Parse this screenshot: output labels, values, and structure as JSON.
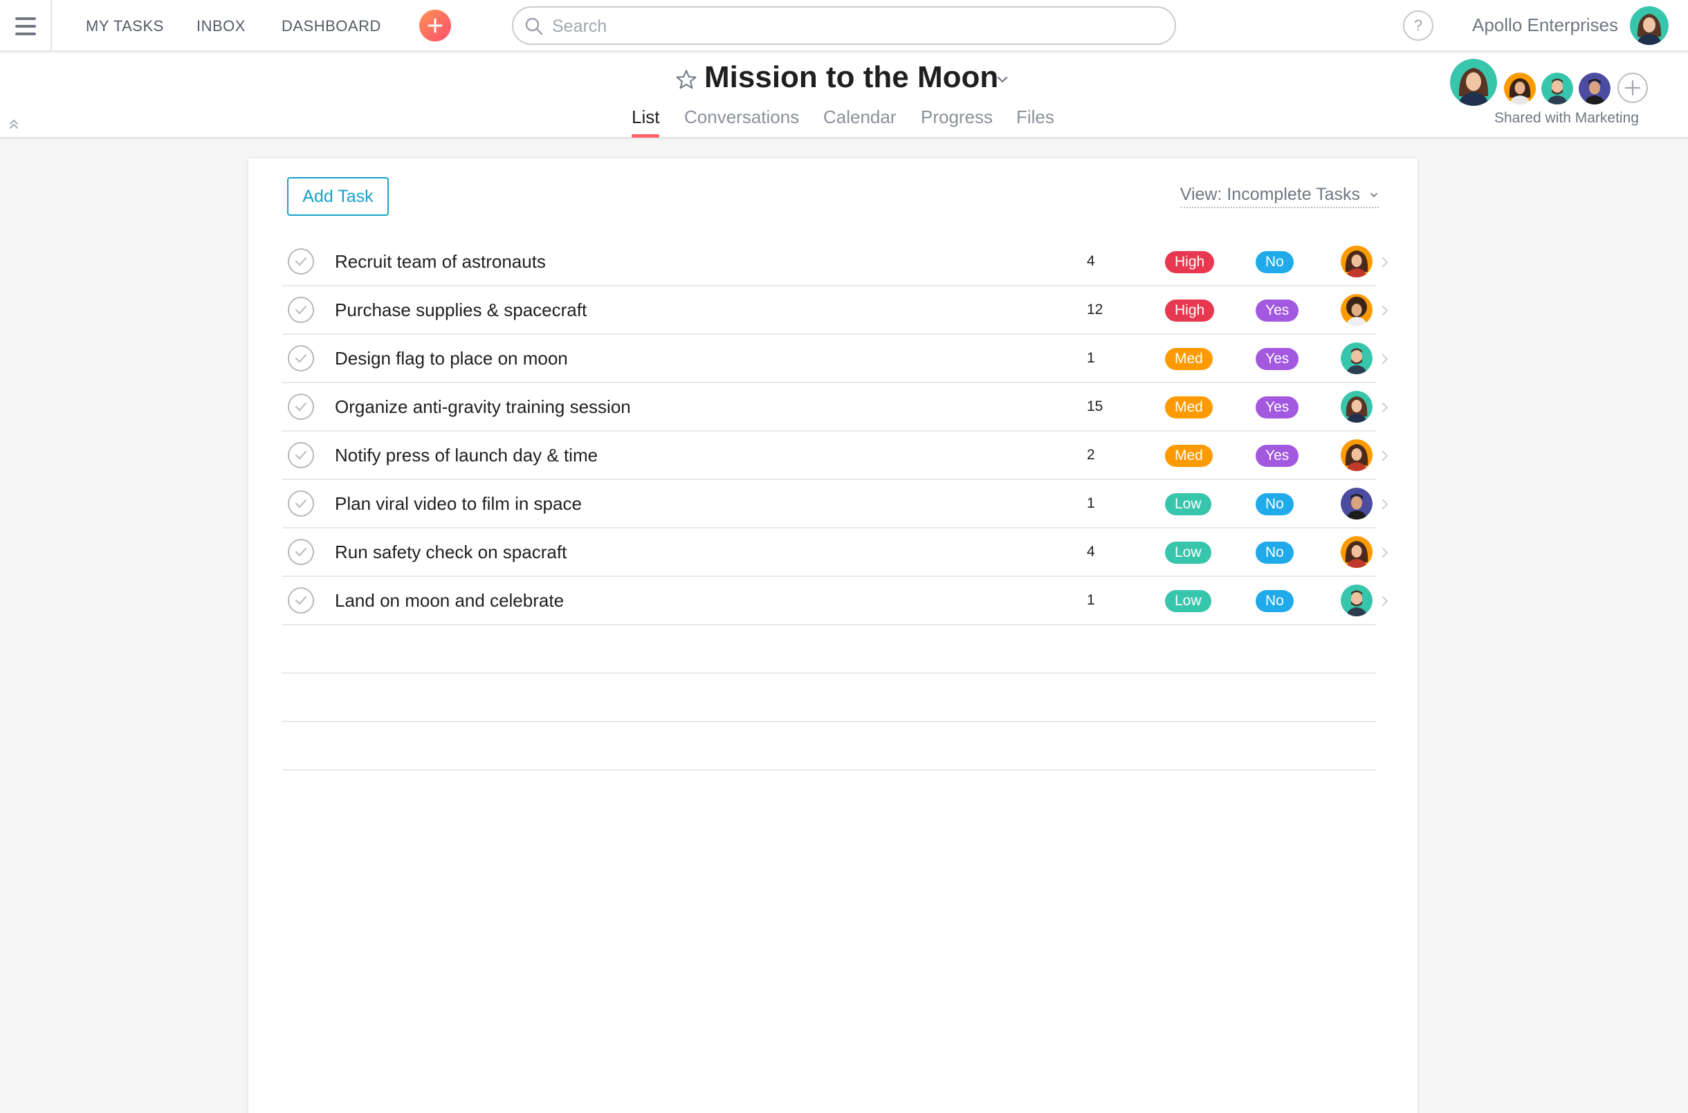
{
  "topbar": {
    "nav": [
      {
        "label": "MY TASKS"
      },
      {
        "label": "INBOX"
      },
      {
        "label": "DASHBOARD"
      }
    ],
    "search_placeholder": "Search",
    "help_label": "?",
    "org_name": "Apollo Enterprises",
    "accent": "#fc636b"
  },
  "project": {
    "title": "Mission to the Moon",
    "tabs": [
      {
        "label": "List",
        "active": true
      },
      {
        "label": "Conversations",
        "active": false
      },
      {
        "label": "Calendar",
        "active": false
      },
      {
        "label": "Progress",
        "active": false
      },
      {
        "label": "Files",
        "active": false
      }
    ],
    "shared_with": "Shared with Marketing"
  },
  "list": {
    "add_task_label": "Add Task",
    "view_label": "View: Incomplete Tasks",
    "tasks": [
      {
        "name": "Recruit team of astronauts",
        "count": "4",
        "priority": "High",
        "flag": "No",
        "assignee": "woman-brunette"
      },
      {
        "name": "Purchase supplies & spacecraft",
        "count": "12",
        "priority": "High",
        "flag": "Yes",
        "assignee": "woman-curly"
      },
      {
        "name": "Design flag to place on moon",
        "count": "1",
        "priority": "Med",
        "flag": "Yes",
        "assignee": "man-beard"
      },
      {
        "name": "Organize anti-gravity training session",
        "count": "15",
        "priority": "Med",
        "flag": "Yes",
        "assignee": "woman-teal"
      },
      {
        "name": "Notify press of launch day & time",
        "count": "2",
        "priority": "Med",
        "flag": "Yes",
        "assignee": "woman-brunette"
      },
      {
        "name": "Plan viral video to film in space",
        "count": "1",
        "priority": "Low",
        "flag": "No",
        "assignee": "man-dark"
      },
      {
        "name": "Run safety check on spacraft",
        "count": "4",
        "priority": "Low",
        "flag": "No",
        "assignee": "woman-brunette"
      },
      {
        "name": "Land on moon and celebrate",
        "count": "1",
        "priority": "Low",
        "flag": "No",
        "assignee": "man-beard"
      }
    ],
    "colors": {
      "High": "#e8384f",
      "Med": "#fd9a00",
      "Low": "#37c5ab",
      "Yes": "#a259e0",
      "No": "#20aaea"
    }
  }
}
